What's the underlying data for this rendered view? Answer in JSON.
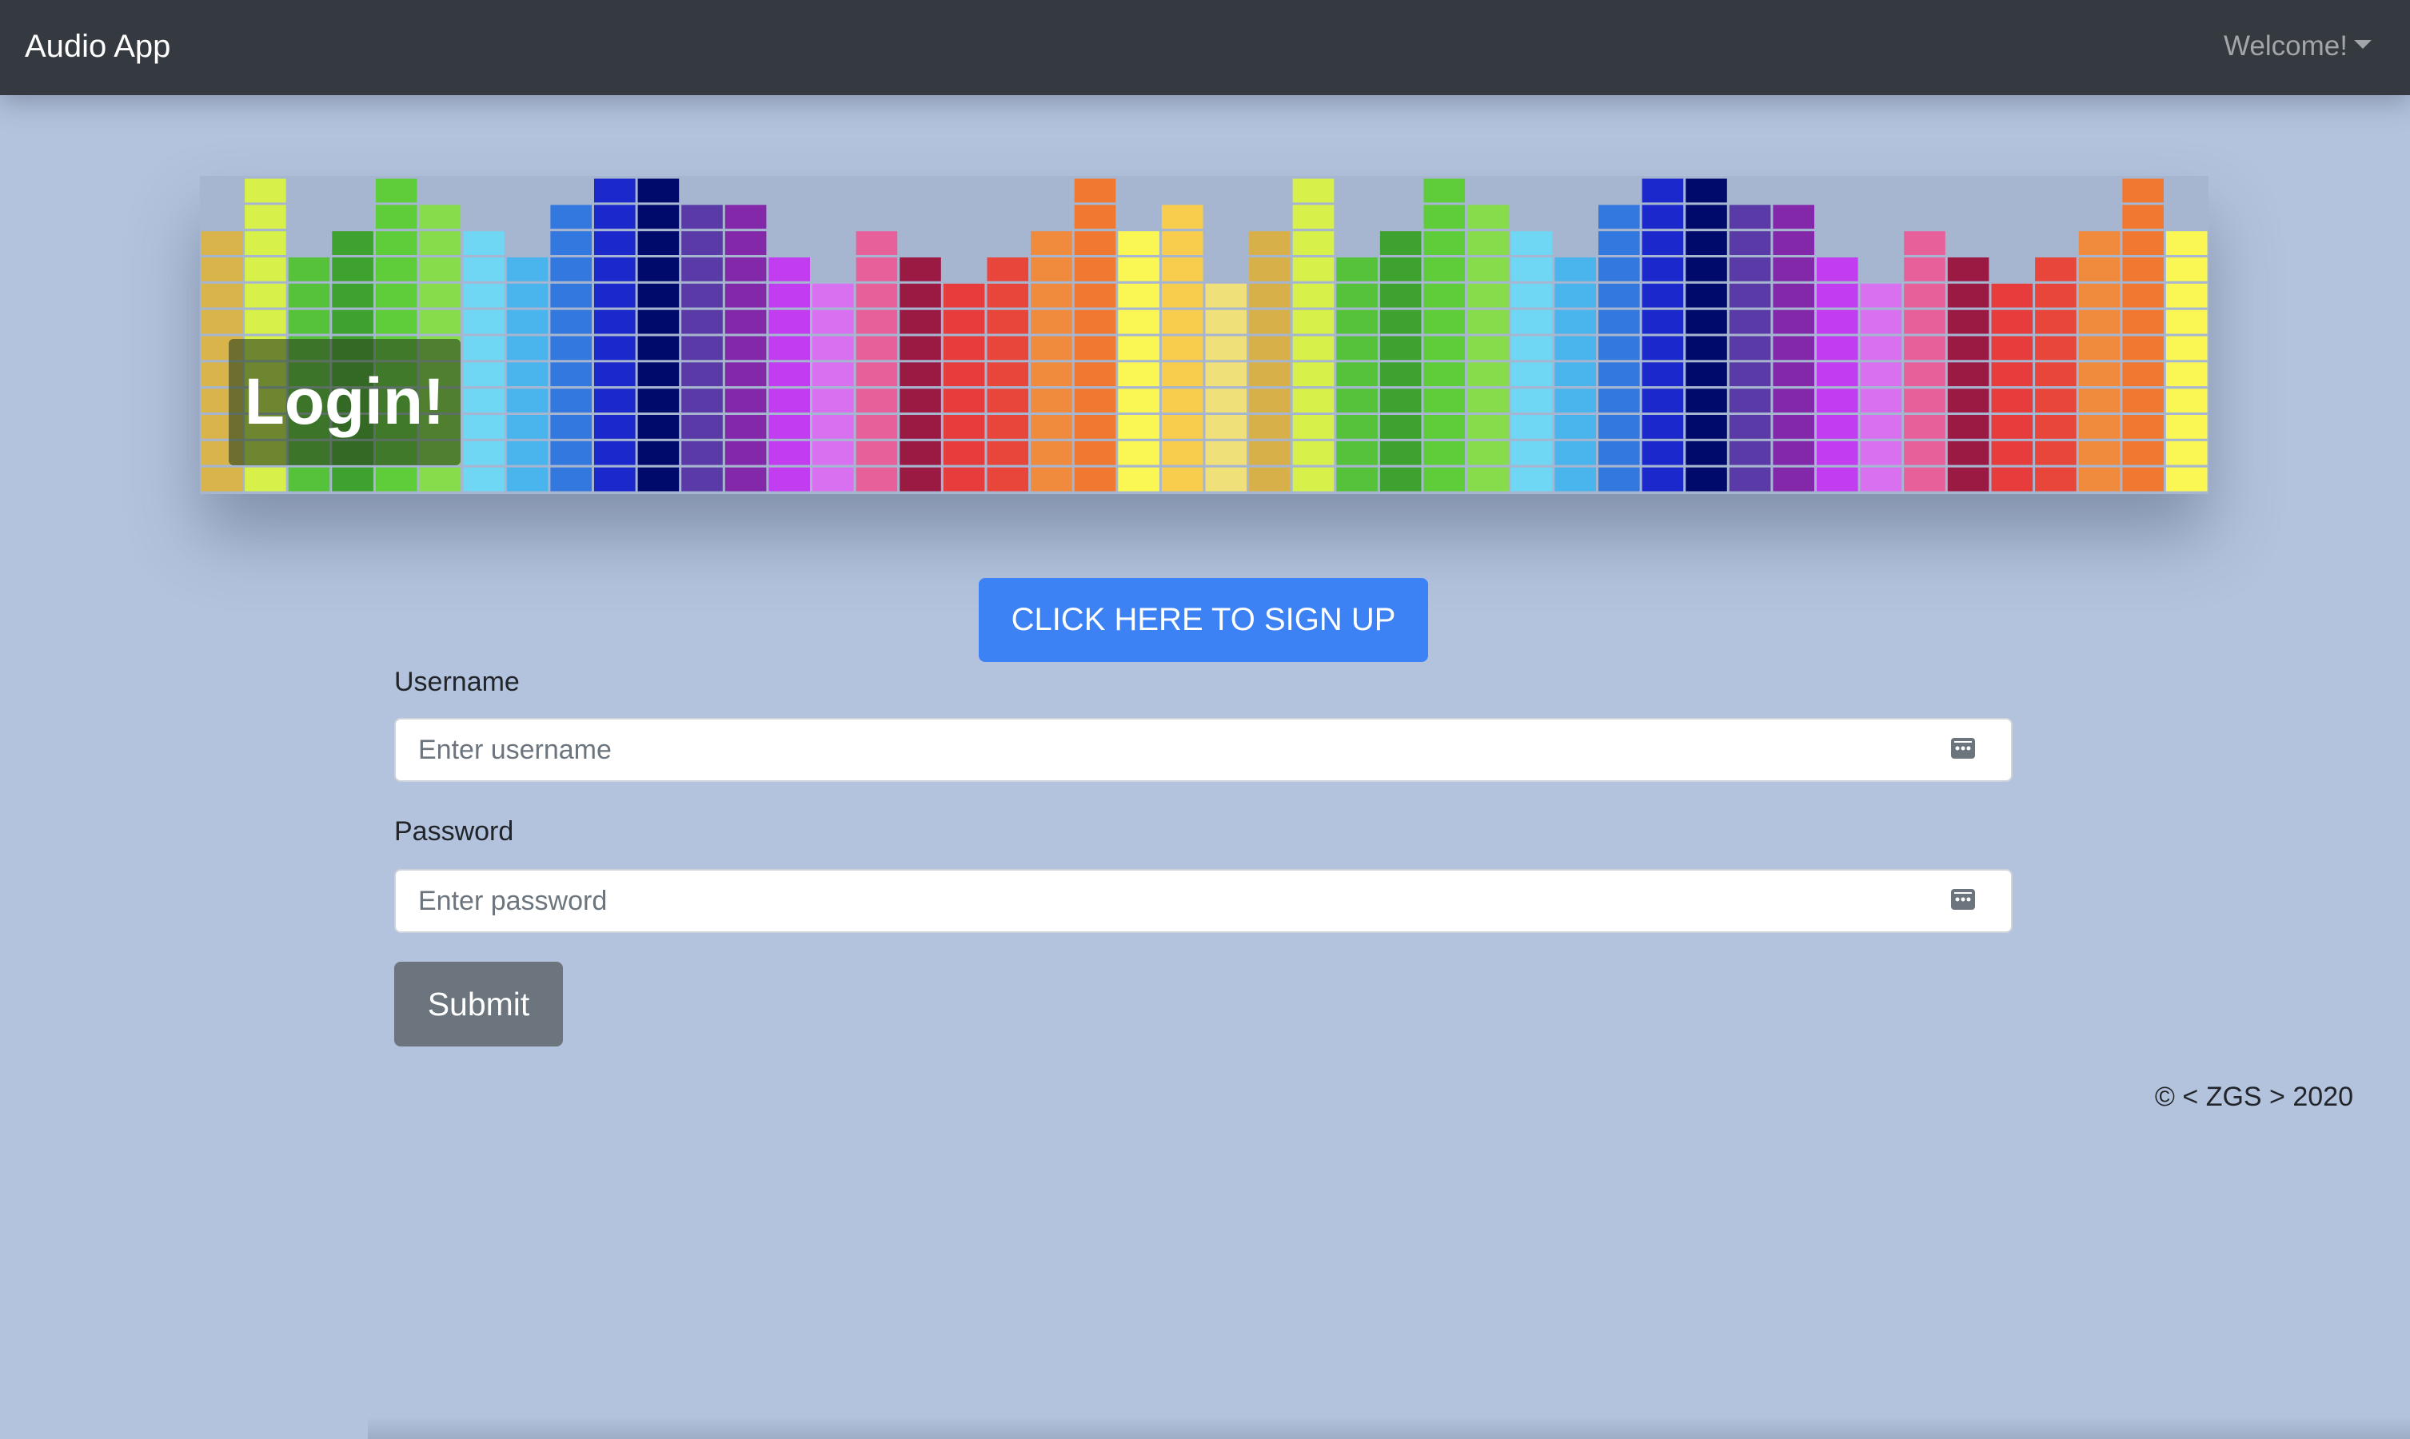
{
  "navbar": {
    "brand": "Audio App",
    "welcome_label": "Welcome!"
  },
  "banner": {
    "title": "Login!"
  },
  "signup_button_label": "CLICK HERE TO SIGN UP",
  "form": {
    "username_label": "Username",
    "username_placeholder": "Enter username",
    "password_label": "Password",
    "password_placeholder": "Enter password",
    "submit_label": "Submit",
    "field_icon": "password-manager-key-icon"
  },
  "footer": {
    "text": "© < ZGS > 2020"
  },
  "colors": {
    "navbar": "#343a40",
    "background": "#b3c3dd",
    "primary_button": "#3c82f4",
    "secondary_button": "#6c757d"
  }
}
